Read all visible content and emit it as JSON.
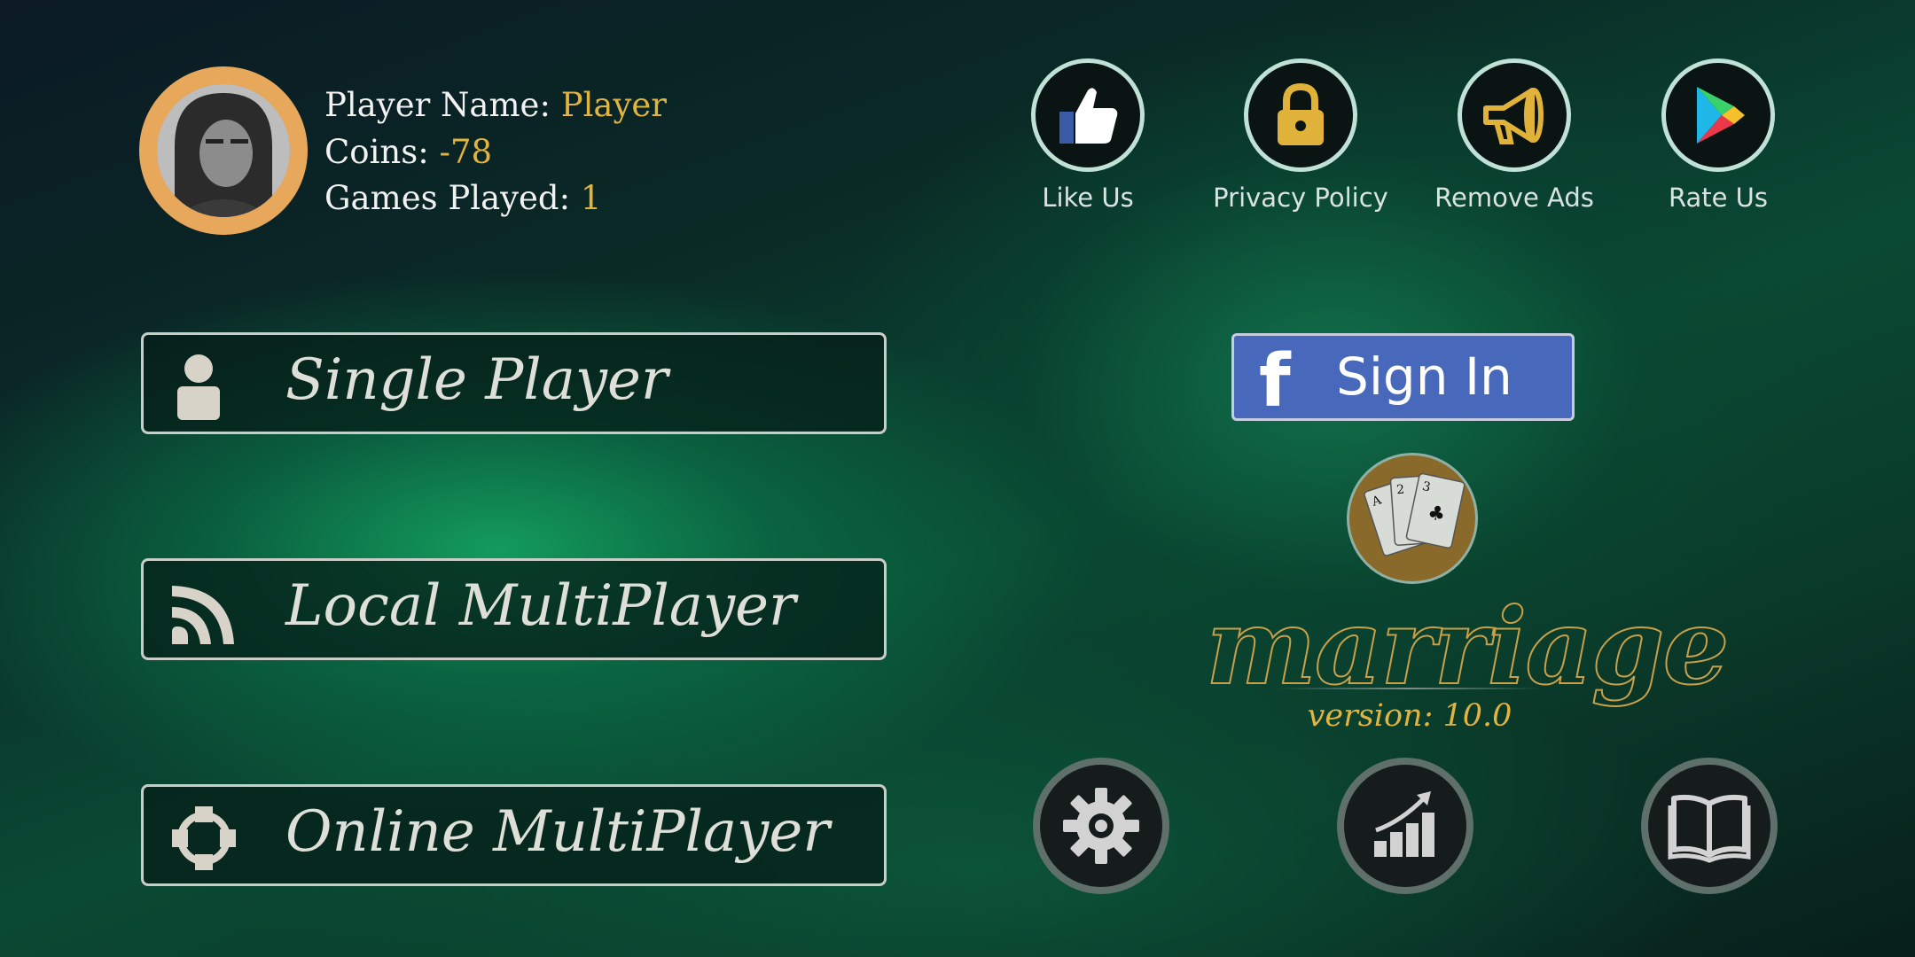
{
  "profile": {
    "name_label": "Player Name:",
    "name_value": "Player",
    "coins_label": "Coins:",
    "coins_value": "-78",
    "games_label": "Games Played:",
    "games_value": "1"
  },
  "top_links": [
    {
      "label": "Like Us",
      "icon": "thumbs-up-icon"
    },
    {
      "label": "Privacy Policy",
      "icon": "lock-icon"
    },
    {
      "label": "Remove Ads",
      "icon": "megaphone-icon"
    },
    {
      "label": "Rate Us",
      "icon": "play-store-icon"
    }
  ],
  "menu": [
    {
      "label": "Single Player",
      "icon": "person-icon"
    },
    {
      "label": "Local MultiPlayer",
      "icon": "wifi-signal-icon"
    },
    {
      "label": "Online MultiPlayer",
      "icon": "network-icon"
    }
  ],
  "facebook": {
    "f": "f",
    "label": "Sign In"
  },
  "logo": {
    "title": "marriage",
    "version": "version: 10.0"
  },
  "bottom_buttons": [
    "settings-gear-icon",
    "stats-chart-icon",
    "rules-book-icon"
  ],
  "colors": {
    "accent": "#e1b43f",
    "facebook": "#4869bb",
    "avatar_ring": "#e8a85c"
  }
}
